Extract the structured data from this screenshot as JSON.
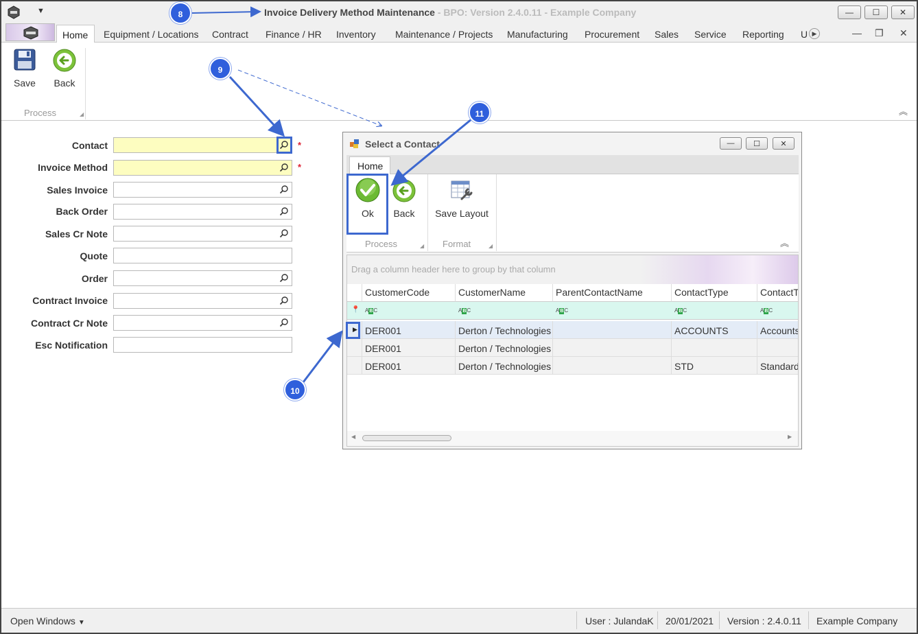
{
  "window": {
    "title": "Invoice Delivery Method Maintenance",
    "subtitle": "- BPO: Version 2.4.0.11 - Example Company"
  },
  "ribbon_tabs": [
    "Home",
    "Equipment / Locations",
    "Contract",
    "Finance / HR",
    "Inventory",
    "Maintenance / Projects",
    "Manufacturing",
    "Procurement",
    "Sales",
    "Service",
    "Reporting",
    "U"
  ],
  "ribbon": {
    "save_label": "Save",
    "back_label": "Back",
    "process_group": "Process"
  },
  "form": {
    "fields": [
      {
        "label": "Contact",
        "required": true,
        "lookup": true,
        "value": ""
      },
      {
        "label": "Invoice Method",
        "required": true,
        "lookup": true,
        "value": ""
      },
      {
        "label": "Sales Invoice",
        "required": false,
        "lookup": true,
        "value": ""
      },
      {
        "label": "Back Order",
        "required": false,
        "lookup": true,
        "value": ""
      },
      {
        "label": "Sales Cr Note",
        "required": false,
        "lookup": true,
        "value": ""
      },
      {
        "label": "Quote",
        "required": false,
        "lookup": false,
        "value": ""
      },
      {
        "label": "Order",
        "required": false,
        "lookup": true,
        "value": ""
      },
      {
        "label": "Contract Invoice",
        "required": false,
        "lookup": true,
        "value": ""
      },
      {
        "label": "Contract Cr Note",
        "required": false,
        "lookup": true,
        "value": ""
      },
      {
        "label": "Esc Notification",
        "required": false,
        "lookup": false,
        "value": ""
      }
    ],
    "required_mark": "*"
  },
  "dialog": {
    "title": "Select a Contact",
    "tab": "Home",
    "ok_label": "Ok",
    "back_label": "Back",
    "save_layout_label": "Save Layout",
    "process_group": "Process",
    "format_group": "Format",
    "group_panel_text": "Drag a column header here to group by that column",
    "columns": [
      "CustomerCode",
      "CustomerName",
      "ParentContactName",
      "ContactType",
      "ContactT"
    ],
    "rows": [
      [
        "DER001",
        "Derton / Technologies",
        "",
        "ACCOUNTS",
        "Accounts"
      ],
      [
        "DER001",
        "Derton / Technologies",
        "",
        "",
        ""
      ],
      [
        "DER001",
        "Derton / Technologies",
        "",
        "STD",
        "Standard"
      ]
    ]
  },
  "callouts": [
    "8",
    "9",
    "10",
    "11"
  ],
  "statusbar": {
    "open_windows": "Open Windows",
    "user": "User : JulandaK",
    "date": "20/01/2021",
    "version": "Version : 2.4.0.11",
    "company": "Example Company"
  },
  "colors": {
    "callout": "#2f5fdc",
    "required_bg": "#fdfdc0",
    "filter_bg": "#d9f7ef",
    "selected_row": "#e4ecf7"
  }
}
